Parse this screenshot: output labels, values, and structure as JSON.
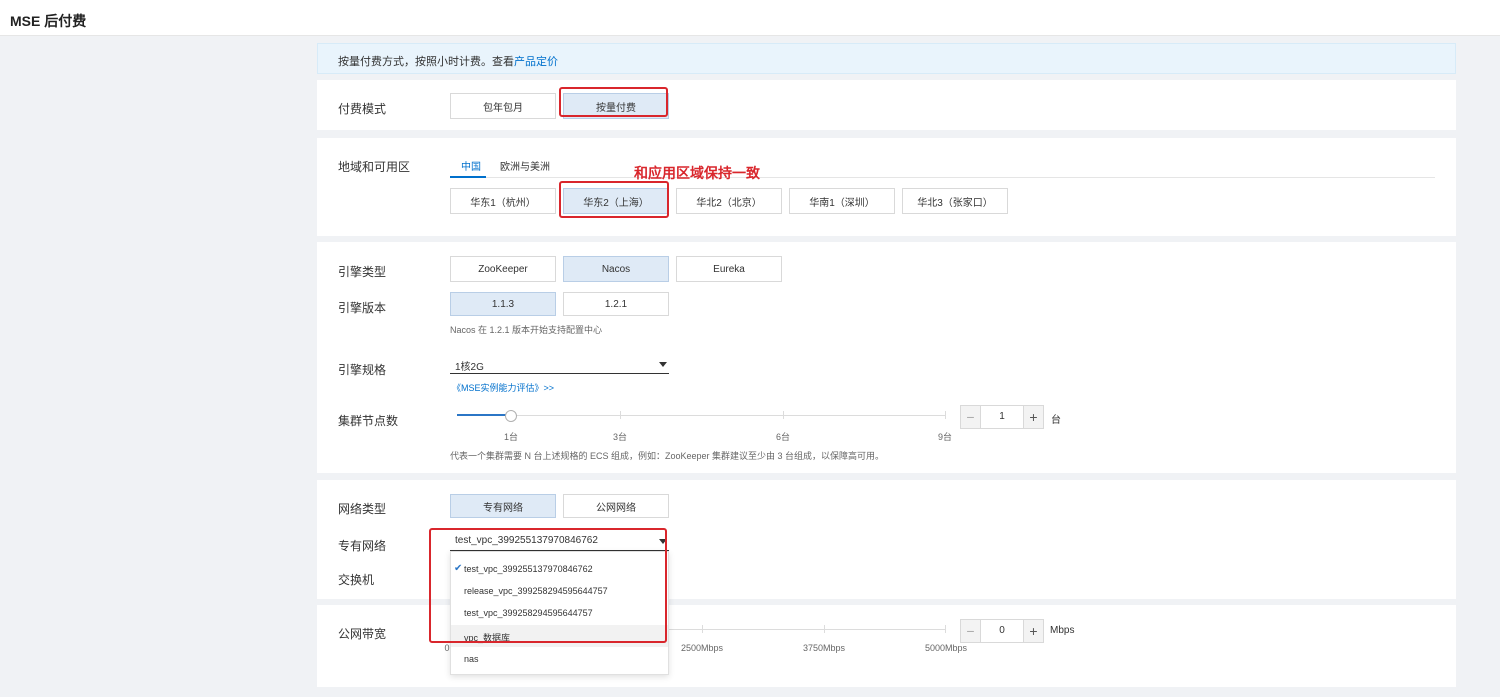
{
  "header": {
    "title": "MSE 后付费"
  },
  "notice": {
    "text": "按量付费方式，按照小时计费。查看",
    "link": "产品定价"
  },
  "billing": {
    "label": "付费模式",
    "options": [
      "包年包月",
      "按量付费"
    ],
    "selected": "按量付费"
  },
  "region": {
    "label": "地域和可用区",
    "tabs": [
      "中国",
      "欧洲与美洲"
    ],
    "active_tab": "中国",
    "options": [
      "华东1（杭州）",
      "华东2（上海）",
      "华北2（北京）",
      "华南1（深圳）",
      "华北3（张家口）"
    ],
    "selected": "华东2（上海）",
    "annotation": "和应用区域保持一致"
  },
  "engine": {
    "type_label": "引擎类型",
    "types": [
      "ZooKeeper",
      "Nacos",
      "Eureka"
    ],
    "type_selected": "Nacos",
    "version_label": "引擎版本",
    "versions": [
      "1.1.3",
      "1.2.1"
    ],
    "version_selected": "1.1.3",
    "version_hint": "Nacos 在 1.2.1 版本开始支持配置中心",
    "spec_label": "引擎规格",
    "spec_value": "1核2G",
    "spec_link": "《MSE实例能力评估》>>"
  },
  "nodes": {
    "label": "集群节点数",
    "ticks": [
      "1台",
      "3台",
      "6台",
      "9台"
    ],
    "value": "1",
    "min": 1,
    "max": 9,
    "unit": "台",
    "hint": "代表一个集群需要 N 台上述规格的 ECS 组成，例如：ZooKeeper 集群建议至少由 3 台组成，以保障高可用。"
  },
  "network": {
    "type_label": "网络类型",
    "types": [
      "专有网络",
      "公网网络"
    ],
    "type_selected": "专有网络",
    "vpc_label": "专有网络",
    "vpc_value": "test_vpc_399255137970846762",
    "switch_label": "交换机",
    "vpc_options": [
      "test_vpc_399255137970846762",
      "release_vpc_399258294595644757",
      "test_vpc_399258294595644757",
      "vpc_数据库",
      "nas"
    ],
    "vpc_checked": "test_vpc_399255137970846762",
    "vpc_hovered": "vpc_数据库"
  },
  "bandwidth": {
    "label": "公网带宽",
    "ticks": [
      "0",
      "2500Mbps",
      "3750Mbps",
      "5000Mbps"
    ],
    "value": "0",
    "unit": "Mbps"
  },
  "colors": {
    "accent": "#0070cc",
    "selected_bg": "#dfeaf6",
    "highlight": "#d9262c"
  }
}
